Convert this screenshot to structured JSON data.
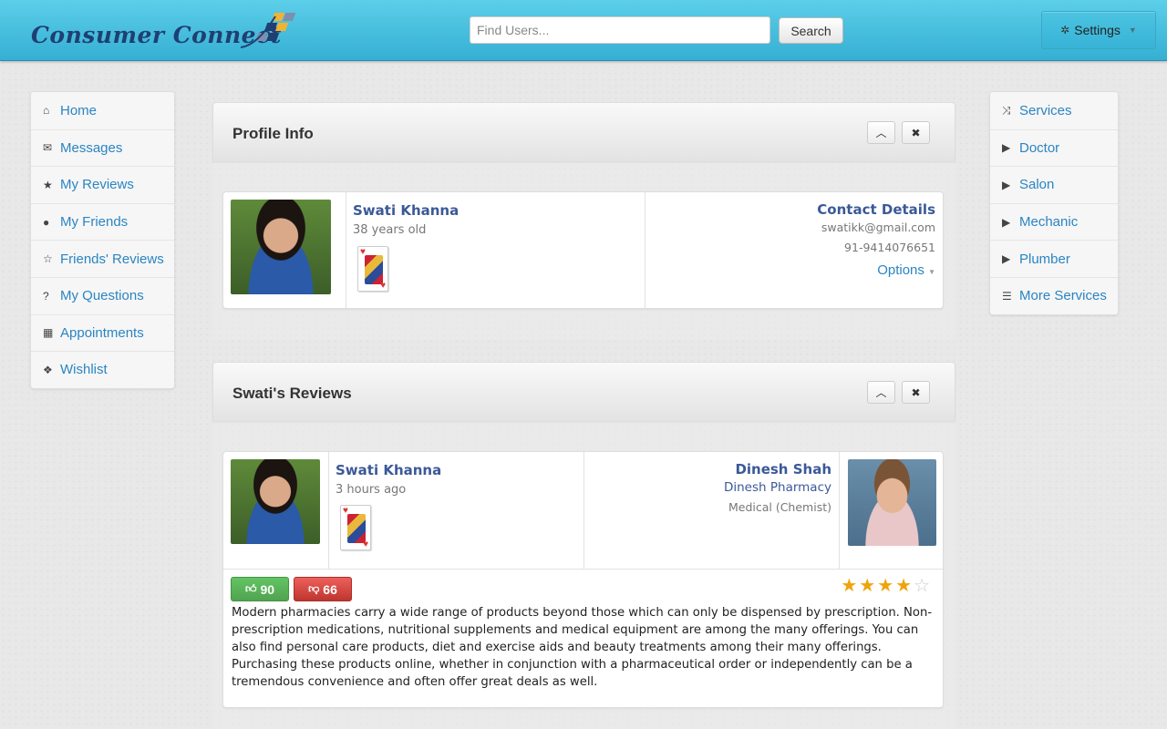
{
  "header": {
    "brand": "Consumer Connect",
    "search_placeholder": "Find Users...",
    "search_button": "Search",
    "settings_label": "Settings",
    "brand_color": "#1f3f73",
    "accent_color": "#35afd3"
  },
  "left_nav": {
    "items": [
      {
        "label": "Home",
        "icon": "home-icon",
        "glyph": "⌂"
      },
      {
        "label": "Messages",
        "icon": "envelope-icon",
        "glyph": "✉"
      },
      {
        "label": "My Reviews",
        "icon": "star-icon",
        "glyph": "★"
      },
      {
        "label": "My Friends",
        "icon": "user-icon",
        "glyph": "●"
      },
      {
        "label": "Friends' Reviews",
        "icon": "star-outline-icon",
        "glyph": "☆"
      },
      {
        "label": "My Questions",
        "icon": "question-icon",
        "glyph": "?"
      },
      {
        "label": "Appointments",
        "icon": "calendar-icon",
        "glyph": "▦"
      },
      {
        "label": "Wishlist",
        "icon": "gift-icon",
        "glyph": "❖"
      }
    ]
  },
  "right_nav": {
    "items": [
      {
        "label": "Services",
        "icon": "shuffle-icon",
        "glyph": "⤨"
      },
      {
        "label": "Doctor",
        "icon": "play-icon",
        "glyph": "▶"
      },
      {
        "label": "Salon",
        "icon": "play-icon",
        "glyph": "▶"
      },
      {
        "label": "Mechanic",
        "icon": "play-icon",
        "glyph": "▶"
      },
      {
        "label": "Plumber",
        "icon": "play-icon",
        "glyph": "▶"
      },
      {
        "label": "More Services",
        "icon": "list-icon",
        "glyph": "☰"
      }
    ]
  },
  "profile_panel": {
    "title": "Profile Info",
    "name": "Swati Khanna",
    "age": "38 years old",
    "contact_heading": "Contact Details",
    "email": "swatikk@gmail.com",
    "phone": "91-9414076651",
    "options_label": "Options"
  },
  "reviews_panel": {
    "title": "Swati's Reviews",
    "review": {
      "author": "Swati Khanna",
      "time": "3 hours ago",
      "target_name": "Dinesh Shah",
      "target_business": "Dinesh Pharmacy",
      "target_category": "Medical (Chemist)",
      "upvotes": "90",
      "downvotes": "66",
      "rating": 4,
      "rating_max": 5,
      "text": "Modern pharmacies carry a wide range of products beyond those which can only be dispensed by prescription. Non-prescription medications, nutritional supplements and medical equipment are among the many offerings. You can also find personal care products, diet and exercise aids and beauty treatments among their many offerings. Purchasing these products online, whether in conjunction with a pharmaceutical order or independently can be a tremendous convenience and often offer great deals as well."
    }
  }
}
